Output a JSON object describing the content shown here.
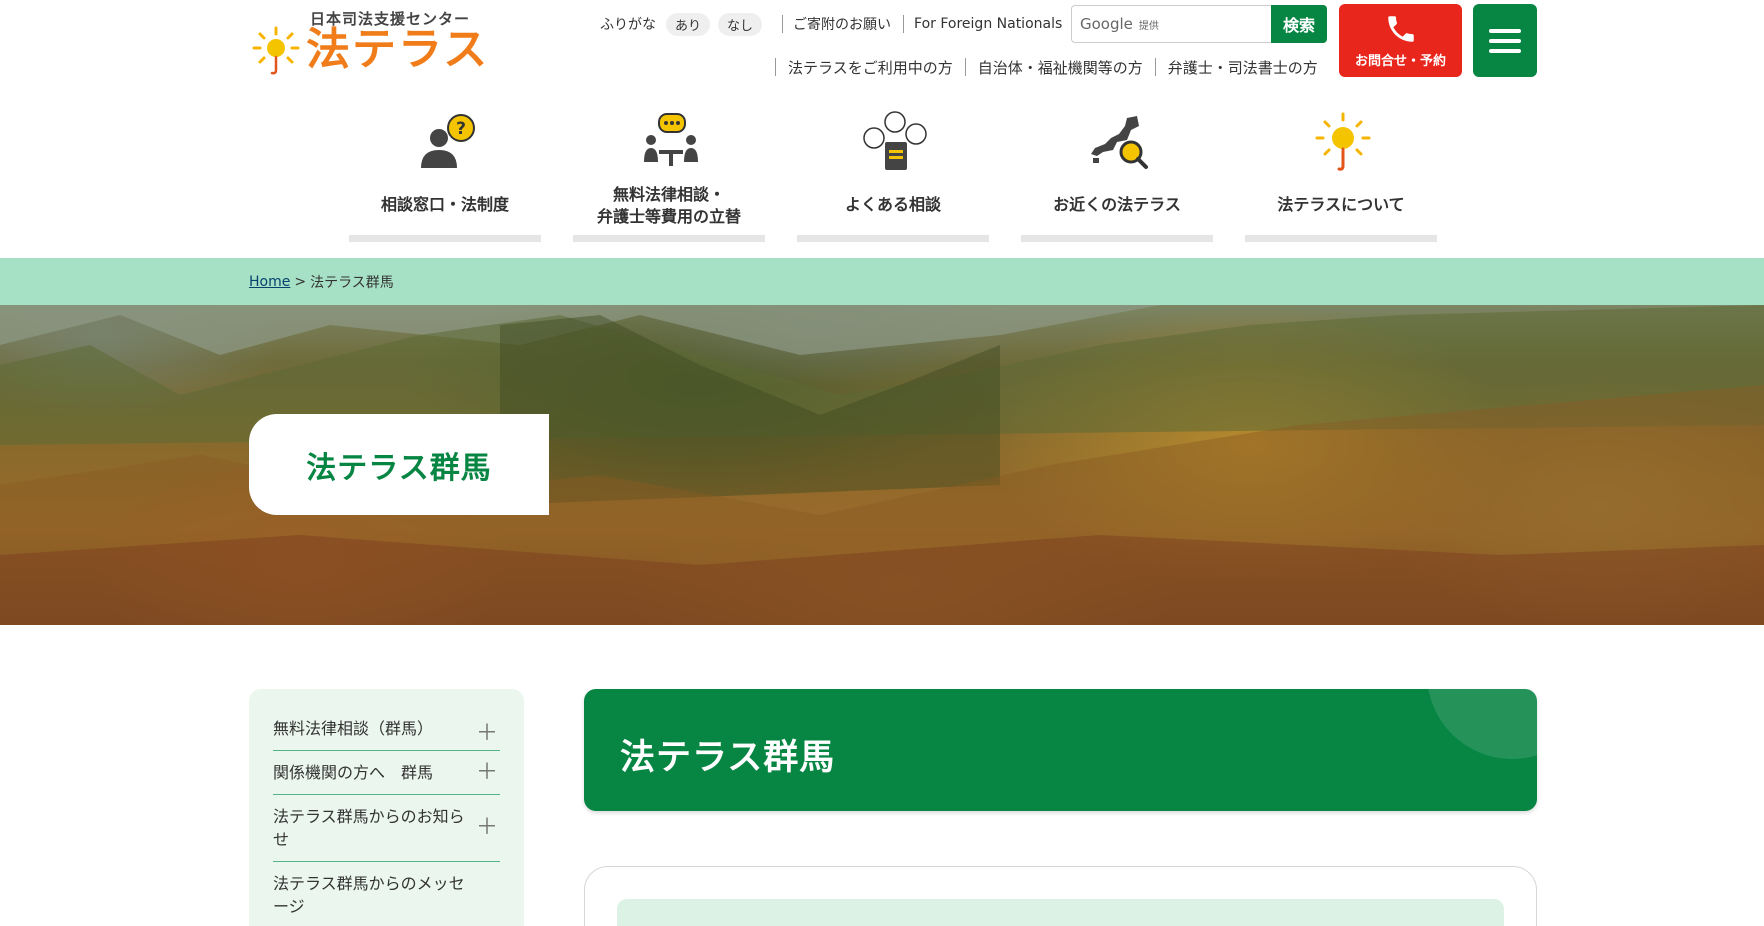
{
  "header": {
    "logo_subtitle": "日本司法支援センター",
    "logo_title": "法テラス",
    "furigana_label": "ふりがな",
    "furigana_on": "あり",
    "furigana_off": "なし",
    "donation_link": "ご寄附のお願い",
    "foreign_link": "For Foreign Nationals",
    "search_brand": "Google",
    "search_brand_sub": "提供",
    "search_button": "検索",
    "contact_button": "お問合せ・予約",
    "menu_icon": "hamburger-icon",
    "audience_links": [
      "法テラスをご利用中の方",
      "自治体・福祉機関等の方",
      "弁護士・司法書士の方"
    ]
  },
  "nav": {
    "items": [
      {
        "label": "相談窓口・法制度",
        "icon": "person-question-icon"
      },
      {
        "label_line1": "無料法律相談・",
        "label_line2": "弁護士等費用の立替",
        "icon": "consultation-icon"
      },
      {
        "label": "よくある相談",
        "icon": "faq-bubbles-icon"
      },
      {
        "label": "お近くの法テラス",
        "icon": "japan-map-search-icon"
      },
      {
        "label": "法テラスについて",
        "icon": "sun-umbrella-icon"
      }
    ]
  },
  "breadcrumb": {
    "home": "Home",
    "separator": ">",
    "current": "法テラス群馬"
  },
  "hero": {
    "title": "法テラス群馬"
  },
  "sidebar": {
    "items": [
      {
        "label": "無料法律相談（群馬）"
      },
      {
        "label": "関係機関の方へ　群馬"
      },
      {
        "label": "法テラス群馬からのお知らせ"
      },
      {
        "label": "法テラス群馬からのメッセージ"
      }
    ],
    "expand_symbol": "＋"
  },
  "main": {
    "page_title": "法テラス群馬"
  },
  "colors": {
    "brand_green": "#078543",
    "brand_orange": "#f07d1a",
    "contact_red": "#e8261c",
    "breadcrumb_bg": "#a7e1c5",
    "sidebar_bg": "#eaf6ee"
  }
}
